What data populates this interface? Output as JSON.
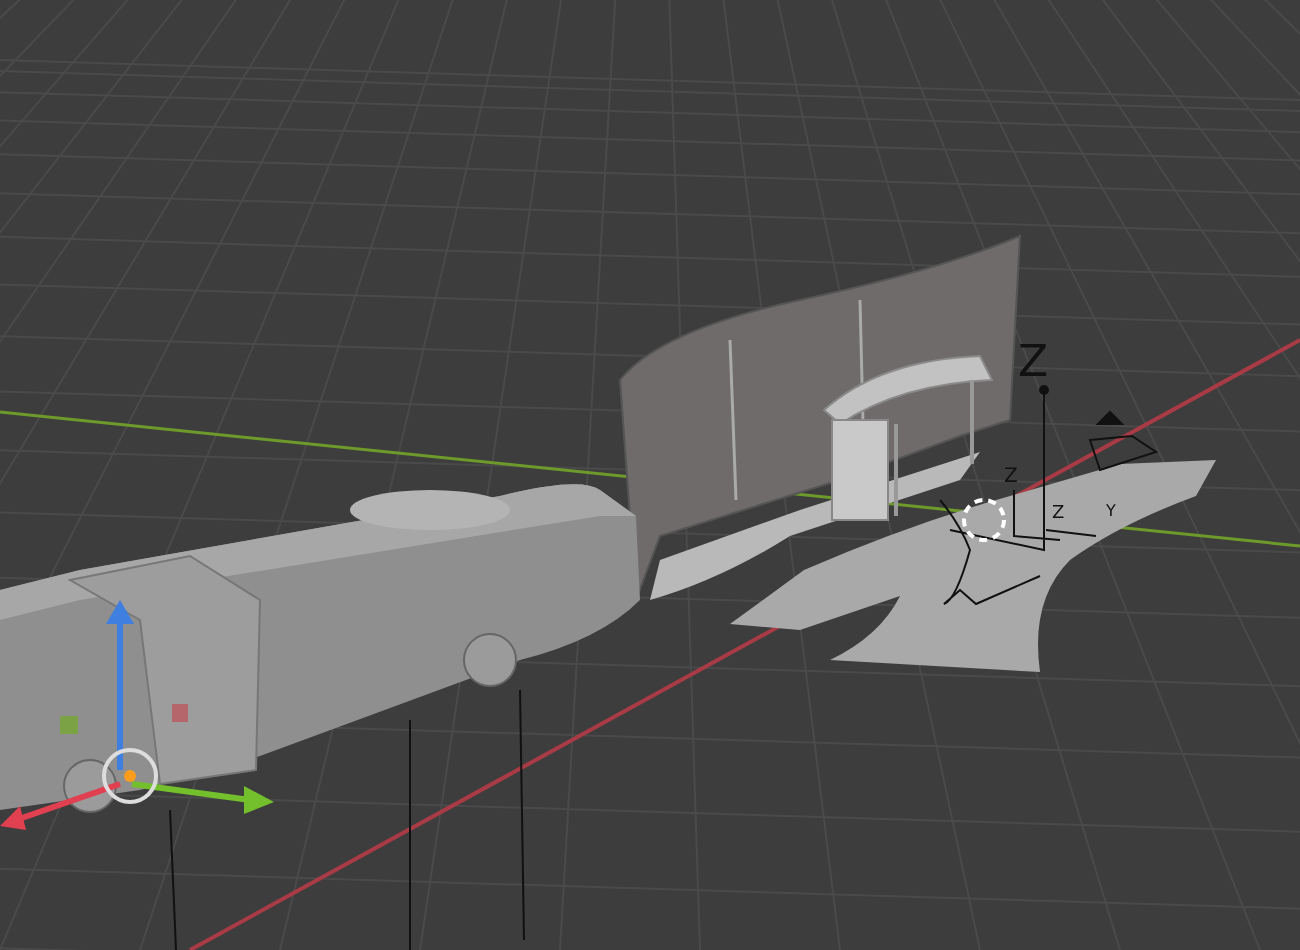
{
  "viewport": {
    "axis_labels": [
      {
        "text": "Z",
        "kind": "large"
      },
      {
        "text": "Z",
        "kind": "small"
      },
      {
        "text": "Z",
        "kind": "small"
      },
      {
        "text": "Y",
        "kind": "small"
      }
    ]
  }
}
